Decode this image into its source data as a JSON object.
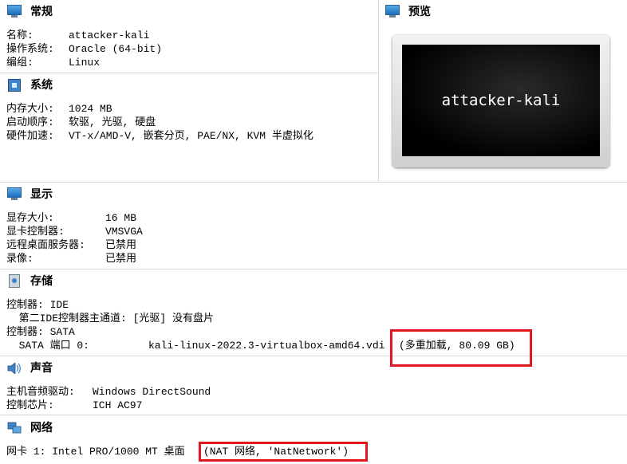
{
  "general": {
    "title": "常规",
    "rows": [
      {
        "label": "名称:",
        "value": "attacker-kali"
      },
      {
        "label": "操作系统:",
        "value": "Oracle (64-bit)"
      },
      {
        "label": "编组:",
        "value": "Linux"
      }
    ]
  },
  "preview": {
    "title": "预览",
    "vm_name": "attacker-kali"
  },
  "system": {
    "title": "系统",
    "rows": [
      {
        "label": "内存大小:",
        "value": "1024 MB"
      },
      {
        "label": "启动顺序:",
        "value": "软驱, 光驱, 硬盘"
      },
      {
        "label": "硬件加速:",
        "value": "VT-x/AMD-V, 嵌套分页, PAE/NX, KVM 半虚拟化"
      }
    ]
  },
  "display": {
    "title": "显示",
    "rows": [
      {
        "label": "显存大小:",
        "value": "16 MB"
      },
      {
        "label": "显卡控制器:",
        "value": "VMSVGA"
      },
      {
        "label": "远程桌面服务器:",
        "value": "已禁用"
      },
      {
        "label": "录像:",
        "value": "已禁用"
      }
    ]
  },
  "storage": {
    "title": "存储",
    "line1": "控制器: IDE",
    "line2": "  第二IDE控制器主通道: [光驱] 没有盘片",
    "line3": "控制器: SATA",
    "sata_port": "  SATA 端口 0:",
    "disk_file": "kali-linux-2022.3-virtualbox-amd64.vdi",
    "disk_info": "(多重加载, 80.09 GB)"
  },
  "audio": {
    "title": "声音",
    "rows": [
      {
        "label": "主机音频驱动:",
        "value": "Windows DirectSound"
      },
      {
        "label": "控制芯片:",
        "value": "ICH AC97"
      }
    ]
  },
  "network": {
    "title": "网络",
    "adapter": "网卡 1: Intel PRO/1000 MT 桌面",
    "mode": "(NAT 网络, 'NatNetwork')"
  },
  "colors": {
    "highlight": "#e3171d",
    "icon_blue": "#3f83c9"
  }
}
